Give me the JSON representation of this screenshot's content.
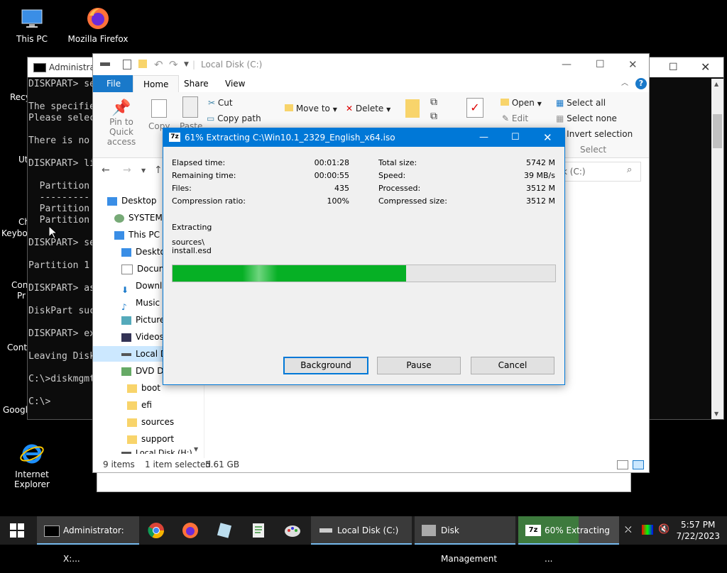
{
  "desktop": {
    "icons": [
      {
        "label": "This PC"
      },
      {
        "label": "Mozilla Firefox"
      },
      {
        "label": "Recy"
      },
      {
        "label": "Ut"
      },
      {
        "label": "Ch"
      },
      {
        "label": "Keybo"
      },
      {
        "label": "Con"
      },
      {
        "label": "Pr"
      },
      {
        "label": "Contr"
      },
      {
        "label": "Googl"
      },
      {
        "label": "Internet Explorer"
      }
    ]
  },
  "cmd": {
    "title": "Administra",
    "lines": [
      "DISKPART> se",
      "",
      "The specifie",
      "Please selec",
      "",
      "There is no",
      "",
      "DISKPART> li",
      "",
      "  Partition",
      "  ---------",
      "  Partition",
      "  Partition",
      "",
      "DISKPART> se",
      "",
      "Partition 1",
      "",
      "DISKPART> as",
      "",
      "DiskPart suc",
      "",
      "DISKPART> ex",
      "",
      "Leaving Disk",
      "",
      "C:\\>diskmgmt",
      "",
      "C:\\>"
    ]
  },
  "explorer": {
    "title": "Local Disk (C:)",
    "tabs": [
      "File",
      "Home",
      "Share",
      "View"
    ],
    "ribbon": {
      "pin": "Pin to Quick access",
      "copy": "Copy",
      "paste": "Paste",
      "cut": "Cut",
      "copy_path": "Copy path",
      "move_to": "Move to",
      "delete": "Delete",
      "new": "New",
      "properties": "Properties",
      "open": "Open",
      "edit": "Edit",
      "select_all": "Select all",
      "select_none": "Select none",
      "invert_selection": "Invert selection",
      "select_group": "Select"
    },
    "search_placeholder": "k (C:)",
    "nav": [
      {
        "label": "Desktop"
      },
      {
        "label": "SYSTEM"
      },
      {
        "label": "This PC"
      },
      {
        "label": "Deskto"
      },
      {
        "label": "Docum"
      },
      {
        "label": "Downlo"
      },
      {
        "label": "Music"
      },
      {
        "label": "Picture"
      },
      {
        "label": "Videos"
      },
      {
        "label": "Local D"
      },
      {
        "label": "DVD Dr"
      },
      {
        "label": "boot"
      },
      {
        "label": "efi"
      },
      {
        "label": "sources"
      },
      {
        "label": "support"
      },
      {
        "label": "Local Disk (H:)"
      }
    ],
    "status": {
      "items": "9 items",
      "selected": "1 item selected",
      "size": "5.61 GB"
    }
  },
  "dialog": {
    "title": "61% Extracting C:\\Win10.1_2329_English_x64.iso",
    "app_icon": "7z",
    "left": [
      {
        "label": "Elapsed time:",
        "value": "00:01:28"
      },
      {
        "label": "Remaining time:",
        "value": "00:00:55"
      },
      {
        "label": "Files:",
        "value": "435"
      },
      {
        "label": "Compression ratio:",
        "value": "100%"
      }
    ],
    "right": [
      {
        "label": "Total size:",
        "value": "5742 M"
      },
      {
        "label": "Speed:",
        "value": "39 MB/s"
      },
      {
        "label": "Processed:",
        "value": "3512 M"
      },
      {
        "label": "Compressed size:",
        "value": "3512 M"
      }
    ],
    "status": "Extracting",
    "path1": "sources\\",
    "path2": "install.esd",
    "progress": 0.61,
    "buttons": {
      "background": "Background",
      "pause": "Pause",
      "cancel": "Cancel"
    }
  },
  "taskbar": {
    "items": [
      {
        "label": "Administrator: X:..."
      },
      {
        "label": "Local Disk (C:)"
      },
      {
        "label": "Disk Management"
      },
      {
        "label": "60% Extracting ..."
      }
    ],
    "time": "5:57 PM",
    "date": "7/22/2023"
  },
  "colors": {
    "accent": "#0078d7",
    "progress": "#06b025",
    "taskbar": "#1e1e1e"
  }
}
